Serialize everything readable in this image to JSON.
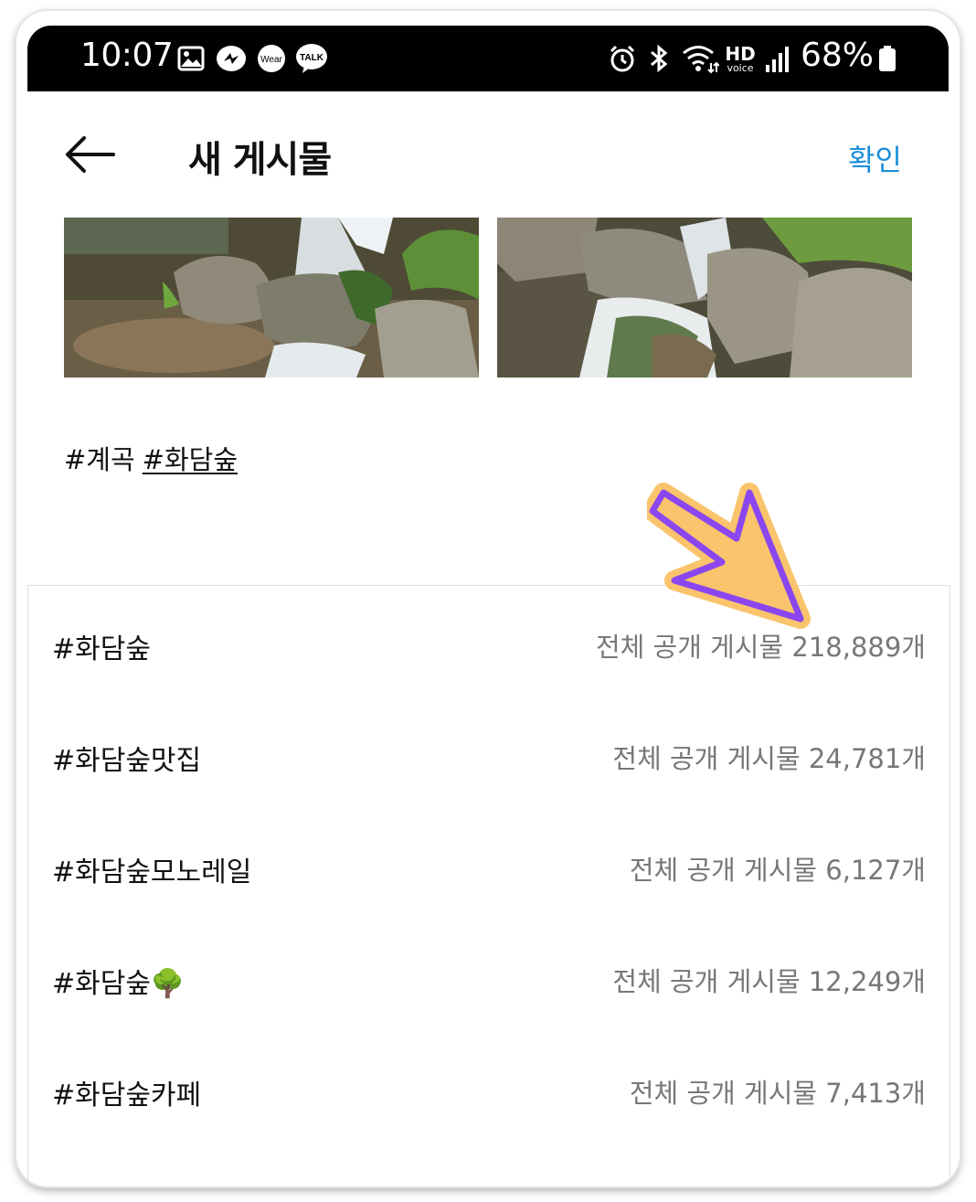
{
  "status_bar": {
    "time": "10:07",
    "battery": "68%",
    "hd_label": "HD",
    "voice_label": "voice",
    "wear_label": "Wear",
    "talk_label": "TALK"
  },
  "header": {
    "title": "새 게시물",
    "confirm_label": "확인"
  },
  "caption": {
    "tag1": "#계곡",
    "tag2": "#화담숲"
  },
  "suggestions": [
    {
      "tag": "#화담숲",
      "count": "전체 공개 게시물 218,889개"
    },
    {
      "tag": "#화담숲맛집",
      "count": "전체 공개 게시물 24,781개"
    },
    {
      "tag": "#화담숲모노레일",
      "count": "전체 공개 게시물 6,127개"
    },
    {
      "tag": "#화담숲🌳",
      "count": "전체 공개 게시물 12,249개"
    },
    {
      "tag": "#화담숲카페",
      "count": "전체 공개 게시물 7,413개"
    }
  ],
  "colors": {
    "accent": "#1a8fd8",
    "annotation_arrow_fill": "#f9c46b",
    "annotation_arrow_stroke": "#8b46f0"
  }
}
